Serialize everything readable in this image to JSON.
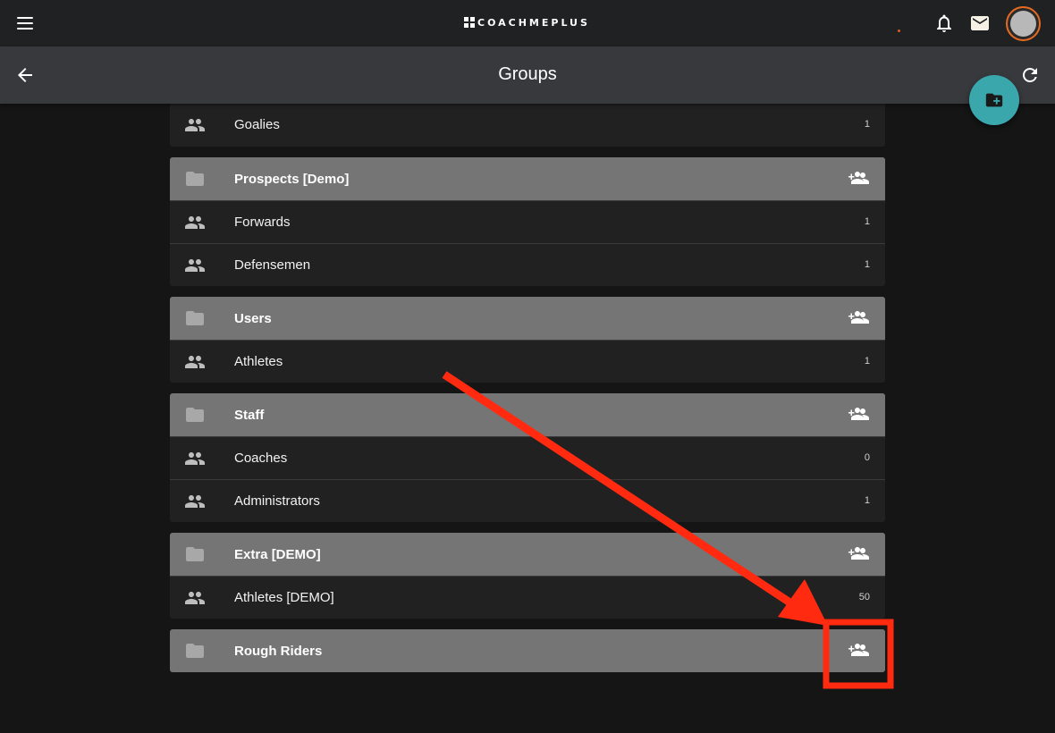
{
  "app": {
    "brand": "COACHMEPLUS"
  },
  "header": {
    "title": "Groups",
    "icons": {
      "menu": "menu-icon",
      "notifications": "bell-icon",
      "messages": "mail-icon",
      "back": "arrow-back-icon",
      "refresh": "refresh-icon",
      "add_folder": "folder-plus-icon"
    }
  },
  "colors": {
    "accent": "#3aa7ad",
    "avatar_ring": "#e56a22",
    "folder_header": "#757575",
    "row_bg": "#212121",
    "annotation": "#ff2a10"
  },
  "partial_group": {
    "subgroups": [
      {
        "name": "Goalies",
        "count": "1"
      }
    ]
  },
  "folders": [
    {
      "name": "Prospects [Demo]",
      "subgroups": [
        {
          "name": "Forwards",
          "count": "1"
        },
        {
          "name": "Defensemen",
          "count": "1"
        }
      ]
    },
    {
      "name": "Users",
      "subgroups": [
        {
          "name": "Athletes",
          "count": "1"
        }
      ]
    },
    {
      "name": "Staff",
      "subgroups": [
        {
          "name": "Coaches",
          "count": "0"
        },
        {
          "name": "Administrators",
          "count": "1"
        }
      ]
    },
    {
      "name": "Extra [DEMO]",
      "subgroups": [
        {
          "name": "Athletes [DEMO]",
          "count": "50"
        }
      ]
    },
    {
      "name": "Rough Riders",
      "subgroups": []
    }
  ],
  "annotation": {
    "type": "arrow-and-box",
    "target": "Rough Riders add-member button"
  }
}
